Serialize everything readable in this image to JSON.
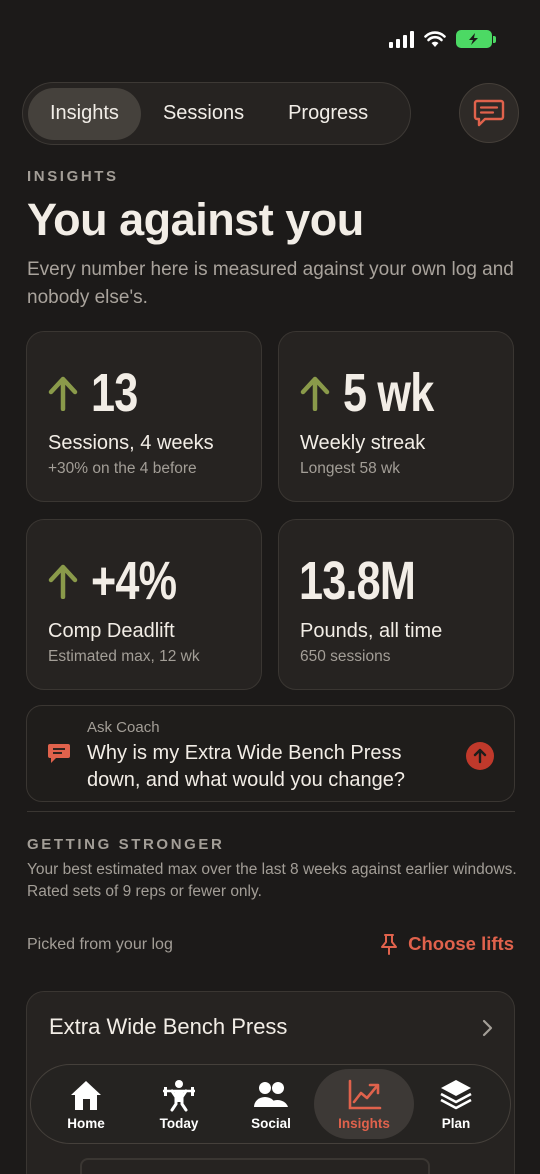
{
  "segments": [
    {
      "label": "Insights",
      "active": true
    },
    {
      "label": "Sessions",
      "active": false
    },
    {
      "label": "Progress",
      "active": false
    }
  ],
  "eyebrow": "INSIGHTS",
  "title": "You against you",
  "subtitle": "Every number here is measured against your own log and nobody else's.",
  "stats": [
    {
      "value": "13",
      "label": "Sessions, 4 weeks",
      "sub": "+30% on the 4 before",
      "trend": "up"
    },
    {
      "value": "5 wk",
      "label": "Weekly streak",
      "sub": "Longest 58 wk",
      "trend": "up"
    },
    {
      "value": "+4%",
      "label": "Comp Deadlift",
      "sub": "Estimated max, 12 wk",
      "trend": "up"
    },
    {
      "value": "13.8M",
      "label": "Pounds, all time",
      "sub": "650 sessions",
      "trend": "none"
    }
  ],
  "coach": {
    "small": "Ask Coach",
    "question": "Why is my Extra Wide Bench Press down, and what would you change?"
  },
  "stronger": {
    "heading": "GETTING STRONGER",
    "desc": "Your best estimated max over the last 8 weeks against earlier windows. Rated sets of 9 reps or fewer only.",
    "picked": "Picked from your log",
    "choose": "Choose lifts"
  },
  "lift_card": {
    "title": "Extra Wide Bench Press"
  },
  "nav": [
    {
      "label": "Home",
      "icon": "home-icon"
    },
    {
      "label": "Today",
      "icon": "lifter-icon"
    },
    {
      "label": "Social",
      "icon": "people-icon"
    },
    {
      "label": "Insights",
      "icon": "chart-icon",
      "active": true
    },
    {
      "label": "Plan",
      "icon": "layers-icon"
    }
  ],
  "colors": {
    "accent": "#e0624c",
    "up_arrow": "#8a9a4a",
    "background": "#1c1a19",
    "card": "#262321"
  }
}
